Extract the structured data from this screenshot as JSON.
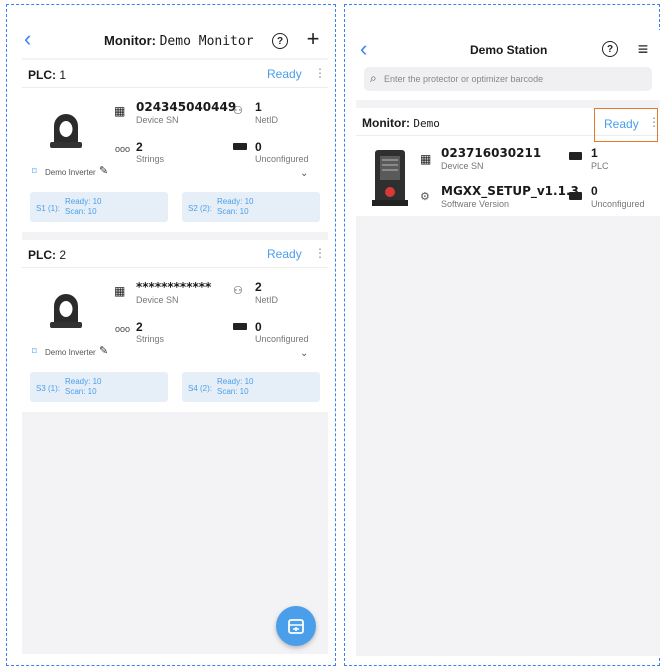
{
  "left": {
    "header": {
      "title_label": "Monitor:",
      "title_value": "Demo Monitor"
    },
    "plcs": [
      {
        "label": "PLC:",
        "number": "1",
        "status": "Ready",
        "device_sn": "024345040449",
        "device_sn_label": "Device SN",
        "netid": "1",
        "netid_label": "NetID",
        "strings": "2",
        "strings_label": "Strings",
        "unconfigured": "0",
        "unconfigured_label": "Unconfigured",
        "inverter": "Demo Inverter",
        "chips": [
          {
            "label": "S1 (1):",
            "ready": "Ready: 10",
            "scan": "Scan: 10"
          },
          {
            "label": "S2 (2):",
            "ready": "Ready: 10",
            "scan": "Scan: 10"
          }
        ]
      },
      {
        "label": "PLC:",
        "number": "2",
        "status": "Ready",
        "device_sn": "************",
        "device_sn_label": "Device SN",
        "netid": "2",
        "netid_label": "NetID",
        "strings": "2",
        "strings_label": "Strings",
        "unconfigured": "0",
        "unconfigured_label": "Unconfigured",
        "inverter": "Demo Inverter",
        "chips": [
          {
            "label": "S3 (1):",
            "ready": "Ready: 10",
            "scan": "Scan: 10"
          },
          {
            "label": "S4 (2):",
            "ready": "Ready: 10",
            "scan": "Scan: 10"
          }
        ]
      }
    ]
  },
  "right": {
    "header": {
      "title": "Demo Station"
    },
    "search": {
      "placeholder": "Enter the protector or optimizer barcode"
    },
    "monitor": {
      "label": "Monitor:",
      "name": "Demo",
      "status": "Ready",
      "device_sn": "023716030211",
      "device_sn_label": "Device SN",
      "plc": "1",
      "plc_label": "PLC",
      "software": "MGXX_SETUP_v1.1.3",
      "software_label": "Software Version",
      "unconfigured": "0",
      "unconfigured_label": "Unconfigured"
    }
  },
  "colors": {
    "accent": "#4a9eea",
    "highlight": "#e07a30",
    "frame": "#3b82f6"
  }
}
